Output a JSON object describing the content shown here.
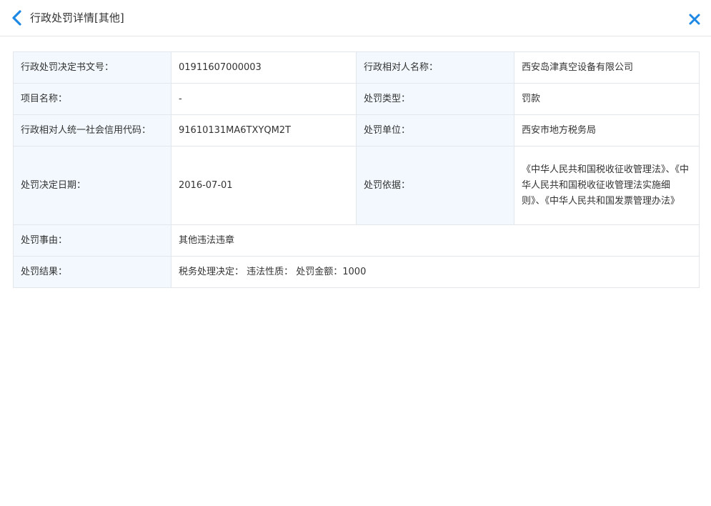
{
  "header": {
    "title": "行政处罚详情[其他]",
    "back_icon": "chevron-left-icon",
    "close_icon": "close-icon",
    "accent_color": "#1e88e5"
  },
  "table": {
    "rows": [
      {
        "label1": "行政处罚决定书文号：",
        "value1": "01911607000003",
        "label2": "行政相对人名称：",
        "value2": "西安岛津真空设备有限公司"
      },
      {
        "label1": "项目名称：",
        "value1": "-",
        "label2": "处罚类型：",
        "value2": "罚款"
      },
      {
        "label1": "行政相对人统一社会信用代码：",
        "value1": "91610131MA6TXYQM2T",
        "label2": "处罚单位：",
        "value2": "西安市地方税务局"
      },
      {
        "label1": "处罚决定日期：",
        "value1": "2016-07-01",
        "label2": "处罚依据：",
        "value2": "《中华人民共和国税收征收管理法》、《中华人民共和国税收征收管理法实施细则》、《中华人民共和国发票管理办法》"
      },
      {
        "label1": "处罚事由：",
        "value1": "其他违法违章"
      },
      {
        "label1": "处罚结果：",
        "value1": "税务处理决定： 违法性质： 处罚金额：1000"
      }
    ]
  }
}
